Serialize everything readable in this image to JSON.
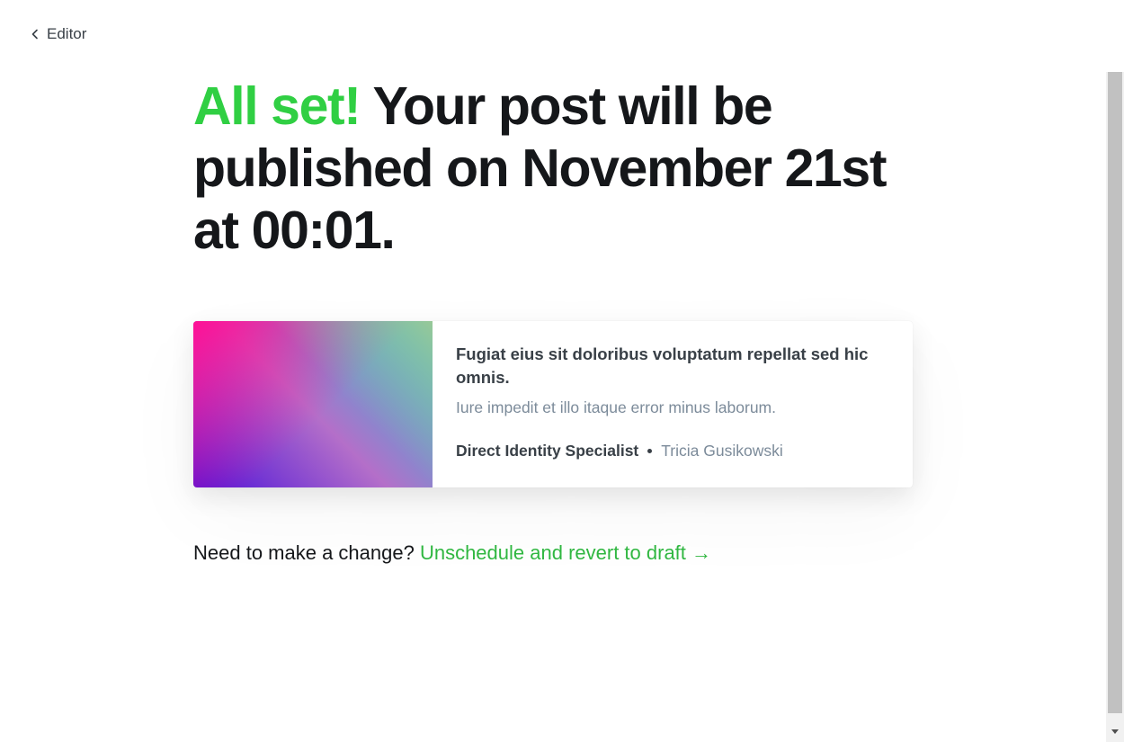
{
  "nav": {
    "back_label": "Editor",
    "back_icon": "chevron-left-icon"
  },
  "headline": {
    "accent_text": "All set!",
    "main_text": " Your post will be published on November 21st at 00:01.",
    "accent_color": "#30cf43"
  },
  "post_card": {
    "title": "Fugiat eius sit doloribus voluptatum repellat sed hic omnis.",
    "excerpt": "Iure impedit et illo itaque error minus laborum.",
    "site_name": "Direct Identity Specialist",
    "author": "Tricia Gusikowski"
  },
  "change": {
    "prompt": "Need to make a change? ",
    "link_label": "Unschedule and revert to draft →",
    "link_color": "#30b741"
  },
  "scrollbar": {
    "arrow_icon": "scroll-down-arrow-icon"
  }
}
